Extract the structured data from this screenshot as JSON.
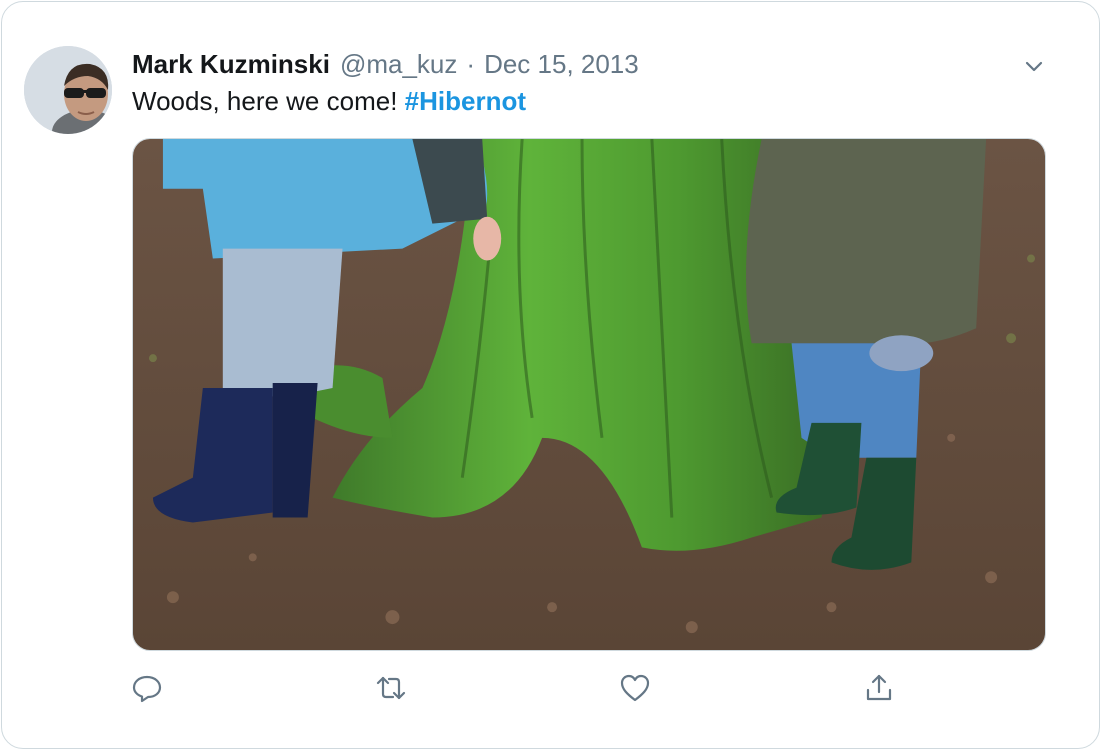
{
  "tweet": {
    "author_name": "Mark Kuzminski",
    "handle": "@ma_kuz",
    "separator": "·",
    "date": "Dec 15, 2013",
    "text_before": "Woods, here we come!",
    "hashtag": "#Hibernot"
  },
  "icons": {
    "menu": "chevron-down-icon",
    "reply": "reply-icon",
    "retweet": "retweet-icon",
    "like": "heart-icon",
    "share": "share-icon"
  },
  "colors": {
    "name": "#14171a",
    "muted": "#657786",
    "hashtag": "#1b95e0",
    "border": "#cfd9de"
  }
}
